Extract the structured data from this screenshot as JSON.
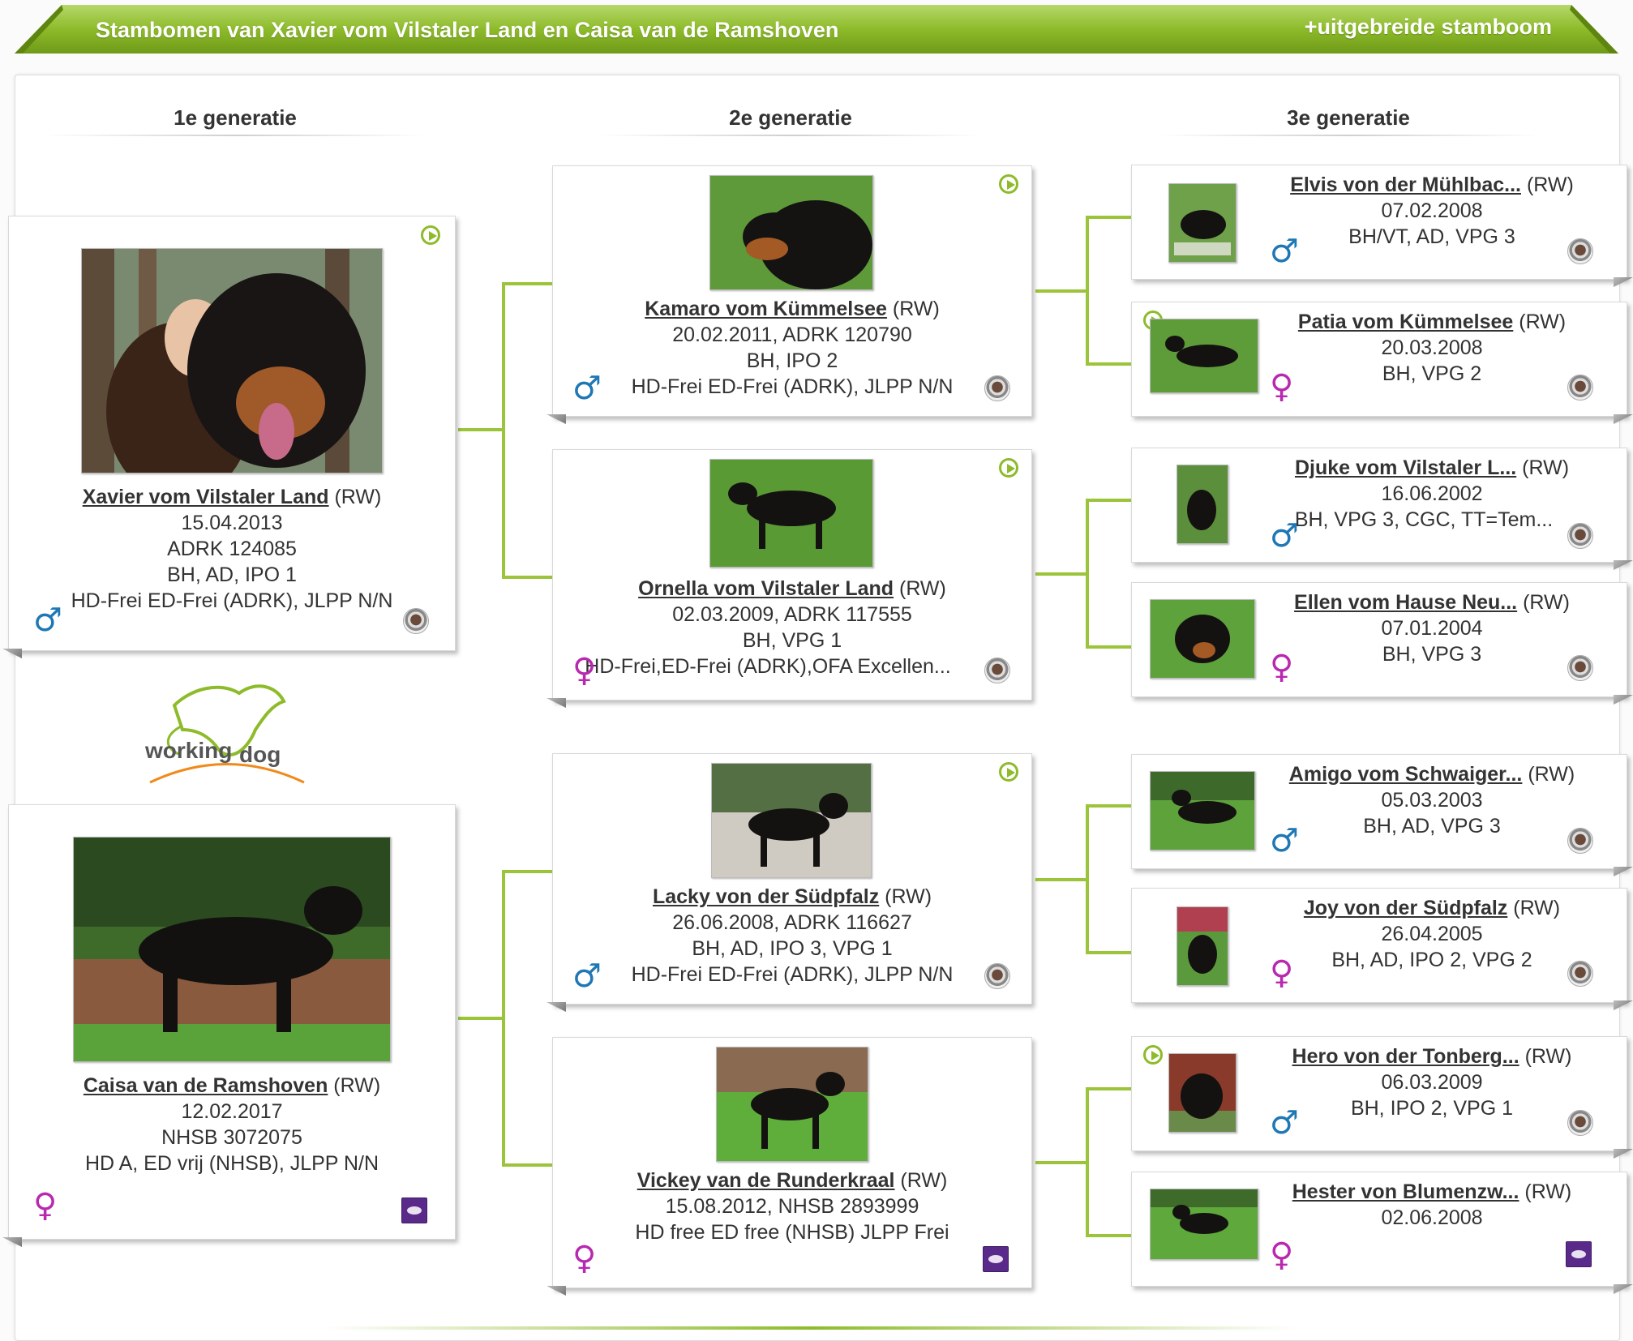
{
  "header": {
    "title": "Stambomen van Xavier vom Vilstaler Land en Caisa van de Ramshoven",
    "extended_link": "+uitgebreide stamboom"
  },
  "generations": [
    "1e generatie",
    "2e generatie",
    "3e generatie"
  ],
  "logo": {
    "text_left": "working",
    "text_right": "dog"
  },
  "colors": {
    "green": "#8dbb2a",
    "male": "#1f77b4",
    "female": "#b829b0",
    "breed_purple": "#5a2a8a"
  },
  "gen1": [
    {
      "name": "Xavier vom Vilstaler Land",
      "suffix": " (RW)",
      "line1": "15.04.2013",
      "line2": "ADRK 124085",
      "line3": "BH, AD, IPO 1",
      "line4": "HD-Frei ED-Frei (ADRK), JLPP N/N",
      "sex": "♂",
      "has_video": true,
      "badge": "rottweiler-club-icon"
    },
    {
      "name": "Caisa van de Ramshoven",
      "suffix": " (RW)",
      "line1": "12.02.2017",
      "line2": "NHSB 3072075",
      "line3": "HD A, ED vrij (NHSB), JLPP N/N",
      "line4": "",
      "sex": "♀",
      "has_video": false,
      "badge": "nhsb-icon"
    }
  ],
  "gen2": [
    {
      "name": "Kamaro vom Kümmelsee",
      "suffix": " (RW)",
      "line1": "20.02.2011, ADRK 120790",
      "line2": "BH, IPO 2",
      "line3": "HD-Frei ED-Frei (ADRK), JLPP N/N",
      "sex": "♂",
      "has_video": true,
      "badge": "rottweiler-club-icon"
    },
    {
      "name": "Ornella vom Vilstaler Land",
      "suffix": " (RW)",
      "line1": "02.03.2009, ADRK 117555",
      "line2": "BH, VPG 1",
      "line3": "HD-Frei,ED-Frei (ADRK),OFA Excellen...",
      "sex": "♀",
      "has_video": true,
      "badge": "rottweiler-club-icon"
    },
    {
      "name": "Lacky von der Südpfalz",
      "suffix": " (RW)",
      "line1": "26.06.2008, ADRK 116627",
      "line2": "BH, AD, IPO 3, VPG 1",
      "line3": "HD-Frei ED-Frei (ADRK), JLPP N/N",
      "sex": "♂",
      "has_video": true,
      "badge": "rottweiler-club-icon"
    },
    {
      "name": "Vickey van de Runderkraal",
      "suffix": " (RW)",
      "line1": "15.08.2012, NHSB 2893999",
      "line2": "HD free ED free (NHSB) JLPP Frei",
      "line3": "",
      "sex": "♀",
      "has_video": false,
      "badge": "nhsb-icon"
    }
  ],
  "gen3": [
    {
      "name": "Elvis von der Mühlbac...",
      "suffix": "(RW)",
      "line1": "07.02.2008",
      "line2": "BH/VT, AD, VPG 3",
      "sex": "♂",
      "has_video": false,
      "badge": "rottweiler-club-icon"
    },
    {
      "name": "Patia vom Kümmelsee",
      "suffix": " (RW)",
      "line1": "20.03.2008",
      "line2": "BH, VPG 2",
      "sex": "♀",
      "has_video": true,
      "badge": "rottweiler-club-icon"
    },
    {
      "name": "Djuke vom Vilstaler L...",
      "suffix": "(RW)",
      "line1": "16.06.2002",
      "line2": "BH, VPG 3, CGC, TT=Tem...",
      "sex": "♂",
      "has_video": false,
      "badge": "rottweiler-club-icon"
    },
    {
      "name": "Ellen vom Hause Neu...",
      "suffix": "(RW)",
      "line1": "07.01.2004",
      "line2": "BH, VPG 3",
      "sex": "♀",
      "has_video": false,
      "badge": "rottweiler-club-icon"
    },
    {
      "name": "Amigo vom Schwaiger...",
      "suffix": "(RW)",
      "line1": "05.03.2003",
      "line2": "BH, AD, VPG 3",
      "sex": "♂",
      "has_video": false,
      "badge": "rottweiler-club-icon"
    },
    {
      "name": "Joy von der Südpfalz",
      "suffix": " (RW)",
      "line1": "26.04.2005",
      "line2": "BH, AD, IPO 2, VPG 2",
      "sex": "♀",
      "has_video": false,
      "badge": "rottweiler-club-icon"
    },
    {
      "name": "Hero von der Tonberg...",
      "suffix": "(RW)",
      "line1": "06.03.2009",
      "line2": "BH, IPO 2, VPG 1",
      "sex": "♂",
      "has_video": true,
      "badge": "rottweiler-club-icon"
    },
    {
      "name": "Hester von Blumenzw...",
      "suffix": "(RW)",
      "line1": "02.06.2008",
      "line2": "",
      "sex": "♀",
      "has_video": false,
      "badge": "nhsb-icon"
    }
  ]
}
